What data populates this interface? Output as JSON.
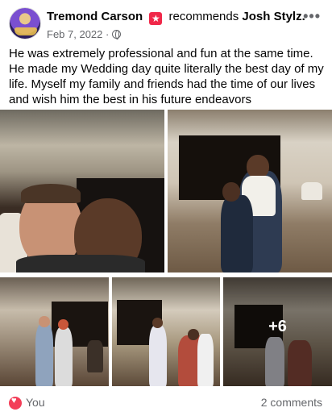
{
  "post": {
    "author": "Tremond Carson",
    "action": "recommends",
    "target": "Josh Stylz.",
    "date": "Feb 7, 2022",
    "separator": "·",
    "more_label": "•••",
    "text": "He was extremely professional and fun at the same time. He made my Wedding day quite literally the best day of my life. Myself my family and friends had the time of our lives and wish him the best in his future endeavors"
  },
  "photos": {
    "more_count": "+6"
  },
  "footer": {
    "reaction_label": "You",
    "comments_label": "2 comments"
  },
  "colors": {
    "recommend_badge": "#f02849",
    "reaction_heart": "#f33e58",
    "meta_text": "#65676b"
  },
  "icons": [
    "recommend-icon",
    "globe-icon",
    "more-icon",
    "heart-reaction-icon"
  ]
}
